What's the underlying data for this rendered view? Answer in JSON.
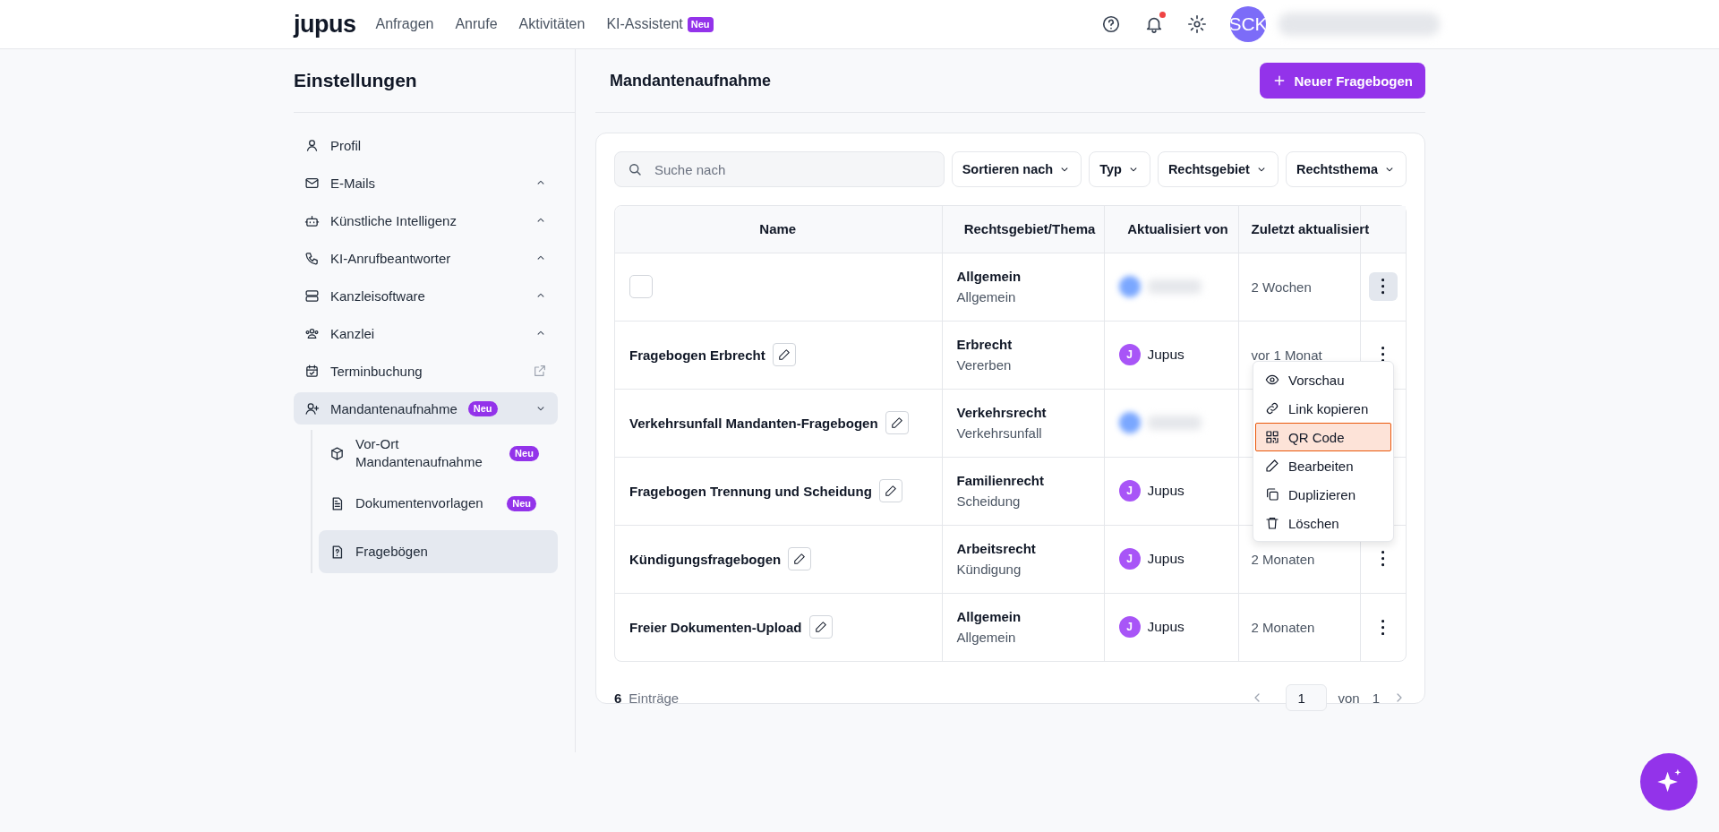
{
  "topbar": {
    "logo": "jupus",
    "nav": [
      {
        "label": "Anfragen"
      },
      {
        "label": "Anrufe"
      },
      {
        "label": "Aktivitäten"
      },
      {
        "label": "KI-Assistent",
        "badge": "Neu"
      }
    ],
    "notification": true,
    "avatar": "SCK"
  },
  "sidebar": {
    "title": "Einstellungen",
    "items": [
      {
        "label": "Profil",
        "kind": "plain",
        "selected": false
      },
      {
        "label": "E-Mails",
        "kind": "group",
        "expanded": false,
        "selected": false
      },
      {
        "label": "Künstliche Intelligenz",
        "kind": "group",
        "expanded": false,
        "selected": false
      },
      {
        "label": "KI-Anrufbeantworter",
        "kind": "group",
        "expanded": false,
        "selected": false
      },
      {
        "label": "Kanzleisoftware",
        "kind": "group",
        "expanded": false,
        "selected": false
      },
      {
        "label": "Kanzlei",
        "kind": "group",
        "expanded": false,
        "selected": false
      },
      {
        "label": "Terminbuchung",
        "kind": "external",
        "selected": false
      },
      {
        "label": "Mandantenaufnahme",
        "kind": "group",
        "expanded": true,
        "selected": true,
        "badge": "Neu",
        "children": [
          {
            "label": "Vor-Ort Mandantenaufnahme",
            "badge": "Neu",
            "selected": false
          },
          {
            "label": "Dokumentenvorlagen",
            "badge": "Neu",
            "selected": false
          },
          {
            "label": "Fragebögen",
            "selected": true
          }
        ]
      }
    ]
  },
  "main": {
    "title": "Mandantenaufnahme",
    "new_button": "Neuer Fragebogen",
    "search": {
      "placeholder": "Suche nach"
    },
    "filters": [
      "Sortieren nach",
      "Typ",
      "Rechtsgebiet",
      "Rechtsthema"
    ],
    "table": {
      "columns": [
        "Name",
        "Rechtsgebiet/Thema",
        "Aktualisiert von",
        "Zuletzt aktualisiert"
      ],
      "rows": [
        {
          "checked": false,
          "area": "Allgemein",
          "topic": "Allgemein",
          "blurred": true,
          "updated": "2 Wochen",
          "highlighted": true
        },
        {
          "name": "Fragebogen Erbrecht",
          "area": "Erbrecht",
          "topic": "Vererben",
          "initial": "J",
          "user": "Jupus",
          "blurred": false,
          "updated": "vor 1 Monat",
          "highlighted": false
        },
        {
          "name": "Verkehrsunfall Mandanten-Fragebogen",
          "area": "Verkehrsrecht",
          "topic": "Verkehrsunfall",
          "blurred": true
        },
        {
          "name": "Fragebogen Trennung und Scheidung",
          "area": "Familienrecht",
          "topic": "Scheidung",
          "initial": "J",
          "user": "Jupus",
          "blurred": false
        },
        {
          "name": "Kündigungsfragebogen",
          "area": "Arbeitsrecht",
          "topic": "Kündigung",
          "initial": "J",
          "user": "Jupus",
          "blurred": false,
          "updated": "2 Monaten",
          "highlighted": false
        },
        {
          "name": "Freier Dokumenten-Upload",
          "area": "Allgemein",
          "topic": "Allgemein",
          "initial": "J",
          "user": "Jupus",
          "blurred": false,
          "updated": "2 Monaten",
          "highlighted": false
        }
      ]
    },
    "menu": {
      "items": [
        {
          "label": "Vorschau",
          "selected": false
        },
        {
          "label": "Link kopieren",
          "selected": false
        },
        {
          "label": "QR Code",
          "selected": true
        },
        {
          "label": "Bearbeiten",
          "selected": false
        },
        {
          "label": "Duplizieren",
          "selected": false
        },
        {
          "label": "Löschen",
          "selected": false
        }
      ]
    },
    "footer": {
      "count": "6",
      "count_label": "Einträge",
      "page": "1",
      "of": "von",
      "total": "1"
    }
  }
}
